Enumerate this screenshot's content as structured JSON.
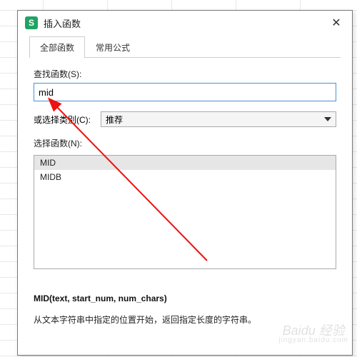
{
  "dialog": {
    "app_icon_letter": "S",
    "title": "插入函数",
    "close_glyph": "✕"
  },
  "tabs": {
    "all": "全部函数",
    "common": "常用公式"
  },
  "search": {
    "label": "查找函数(S):",
    "value": "mid"
  },
  "category": {
    "label": "或选择类别(C):",
    "selected": "推荐"
  },
  "list": {
    "label": "选择函数(N):",
    "items": [
      "MID",
      "MIDB"
    ]
  },
  "description": {
    "signature": "MID(text, start_num, num_chars)",
    "detail": "从文本字符串中指定的位置开始，返回指定长度的字符串。"
  },
  "watermark": {
    "brand": "Baidu 经验",
    "sub": "jingyan.baidu.com"
  }
}
